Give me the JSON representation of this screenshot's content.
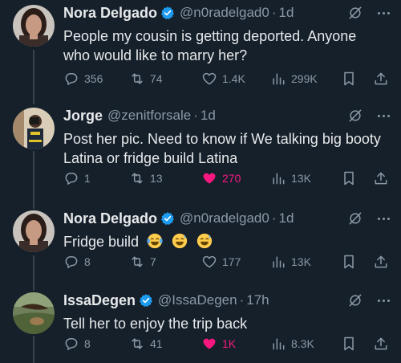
{
  "tweets": [
    {
      "name": "Nora Delgado",
      "handle": "@n0radelgad0",
      "time": "1d",
      "text": "People my cousin is getting deported. Anyone who would like to marry her?",
      "replies": "356",
      "retweets": "74",
      "likes": "1.4K",
      "views": "299K",
      "liked": false,
      "verified": true,
      "avatar": "woman-portrait"
    },
    {
      "name": "Jorge",
      "handle": "@zenitforsale",
      "time": "1d",
      "text": "Post her pic. Need to know if We talking big booty Latina or fridge build Latina",
      "replies": "1",
      "retweets": "13",
      "likes": "270",
      "views": "13K",
      "liked": true,
      "verified": false,
      "avatar": "man-mirror-selfie"
    },
    {
      "name": "Nora Delgado",
      "handle": "@n0radelgad0",
      "time": "1d",
      "text": "Fridge build",
      "emojis": [
        "crying-laughing-emoji",
        "grinning-sweat-emoji",
        "grinning-sweat-emoji"
      ],
      "replies": "8",
      "retweets": "7",
      "likes": "177",
      "views": "13K",
      "liked": false,
      "verified": true,
      "avatar": "woman-portrait"
    },
    {
      "name": "IssaDegen",
      "handle": "@IssaDegen",
      "time": "17h",
      "text": "Tell her to enjoy the trip back",
      "replies": "8",
      "retweets": "41",
      "likes": "1K",
      "views": "8.3K",
      "liked": true,
      "verified": true,
      "avatar": "outdoor-photo"
    }
  ],
  "colors": {
    "background": "#15202b",
    "text": "#e7e9ea",
    "muted": "#8b98a5",
    "verified": "#1d9bf0",
    "like": "#f91880"
  }
}
